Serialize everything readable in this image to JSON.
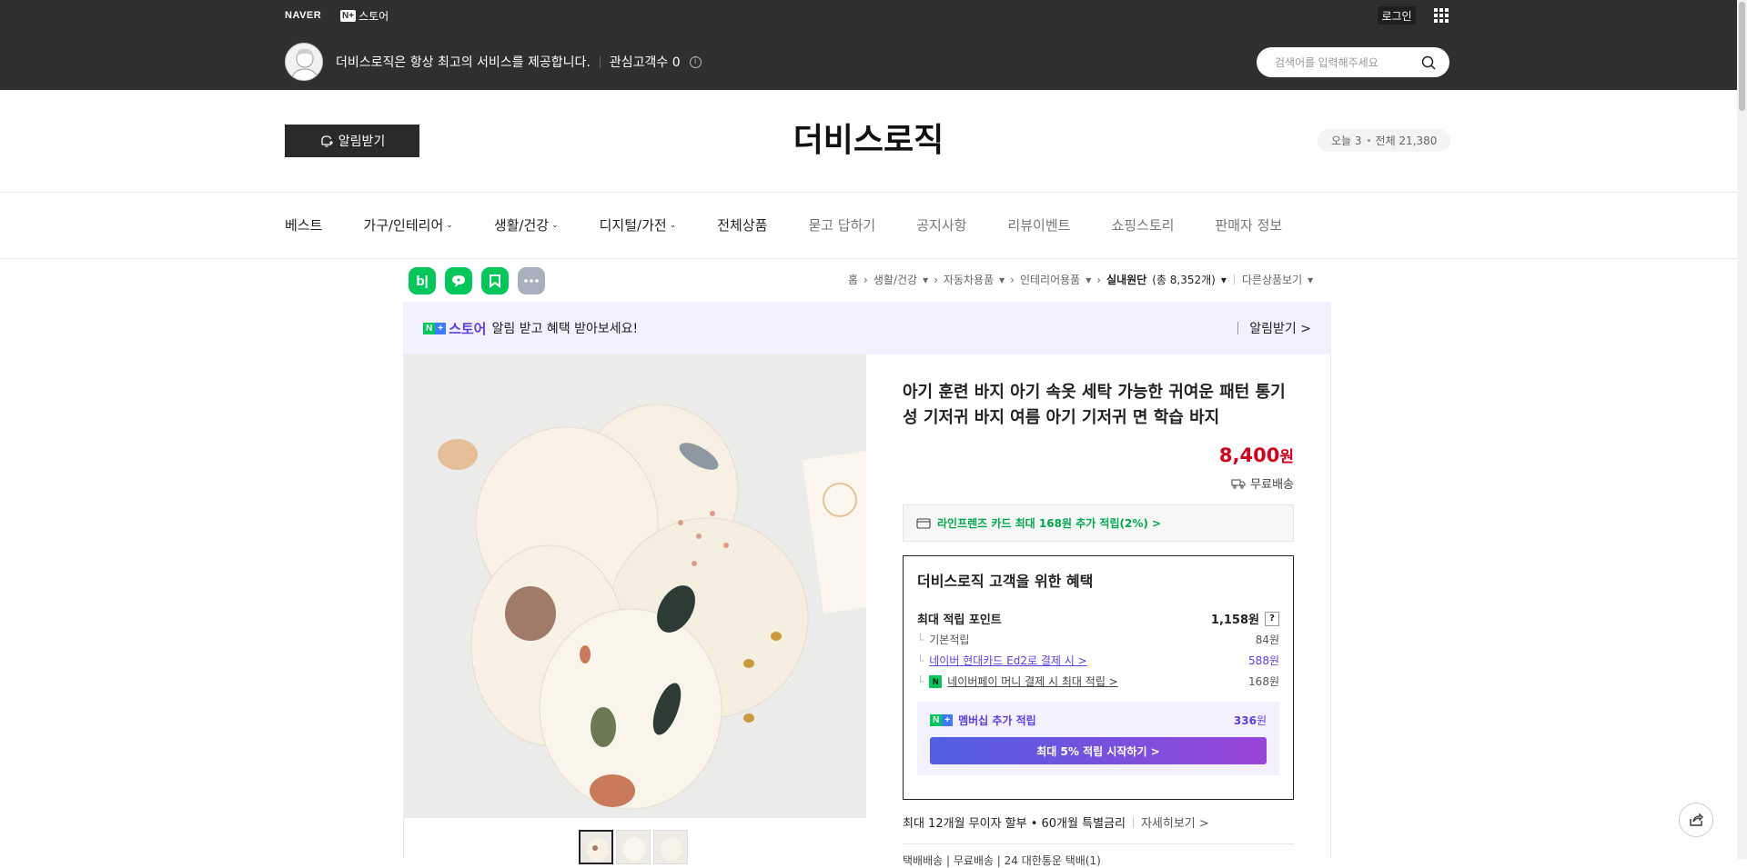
{
  "topbar": {
    "naver_logo": "NAVER",
    "nplus_badge": "N+",
    "nplus_text": "스토어",
    "login_label": "로그인",
    "store_intro": "더비스로직은 항상 최고의 서비스를 제공합니다.",
    "followers_label": "관심고객수 0",
    "info_icon_text": "i",
    "search_placeholder": "검색어를 입력해주세요"
  },
  "header": {
    "alarm_label": "알림받기",
    "store_title": "더비스로직",
    "visitors_today": "오늘 3",
    "visitors_total": "전체 21,380"
  },
  "nav": {
    "items": [
      {
        "label": "베스트"
      },
      {
        "label": "가구/인테리어"
      },
      {
        "label": "생활/건강"
      },
      {
        "label": "디지털/가전"
      },
      {
        "label": "전체상품"
      },
      {
        "label": "묻고 답하기"
      },
      {
        "label": "공지사항"
      },
      {
        "label": "리뷰이벤트"
      },
      {
        "label": "쇼핑스토리"
      },
      {
        "label": "판매자 정보"
      }
    ]
  },
  "breadcrumb": {
    "home": "홈",
    "c1": "생활/건강",
    "c2": "자동차용품",
    "c3": "인테리어용품",
    "c4": "실내원단",
    "c4_count": "(총 8,352개)",
    "other": "다른상품보기"
  },
  "banner": {
    "brand": "스토어",
    "text": "알림 받고 혜택 받아보세요!",
    "link": "알림받기 >"
  },
  "product": {
    "title": "아기 훈련 바지 아기 속옷 세탁 가능한 귀여운 패턴 통기성 기저귀 바지 여름 아기 기저귀 면 학습 바지",
    "price": "8,400",
    "price_unit": "원",
    "shipping": "무료배송",
    "card_benefit": "라인프렌즈 카드 최대 168원 추가 적립(2%) >"
  },
  "benefit": {
    "title": "더비스로직 고객을 위한 혜택",
    "max_points_label": "최대 적립 포인트",
    "max_points_value": "1,158원",
    "help": "?",
    "tree": "└",
    "rows": [
      {
        "label": "기본적립",
        "value": "84원"
      },
      {
        "label": "네이버 현대카드 Ed2로 결제 시 >",
        "value": "588원"
      },
      {
        "label": "네이버페이 머니 결제 시 최대 적립 >",
        "value": "168원"
      }
    ],
    "npay_icon": "N",
    "membership_label": "멤버십 추가 적립",
    "membership_value": "336",
    "membership_unit": "원",
    "membership_btn": "최대 5% 적립 시작하기 >"
  },
  "install": {
    "text": "최대 12개월 무이자 할부 • 60개월 특별금리",
    "more": "자세히보기 >"
  },
  "cutoff_text": "택배배송 | 무료배송 | 24 대한통운 택배(1)",
  "social": {
    "blog": "b|"
  }
}
